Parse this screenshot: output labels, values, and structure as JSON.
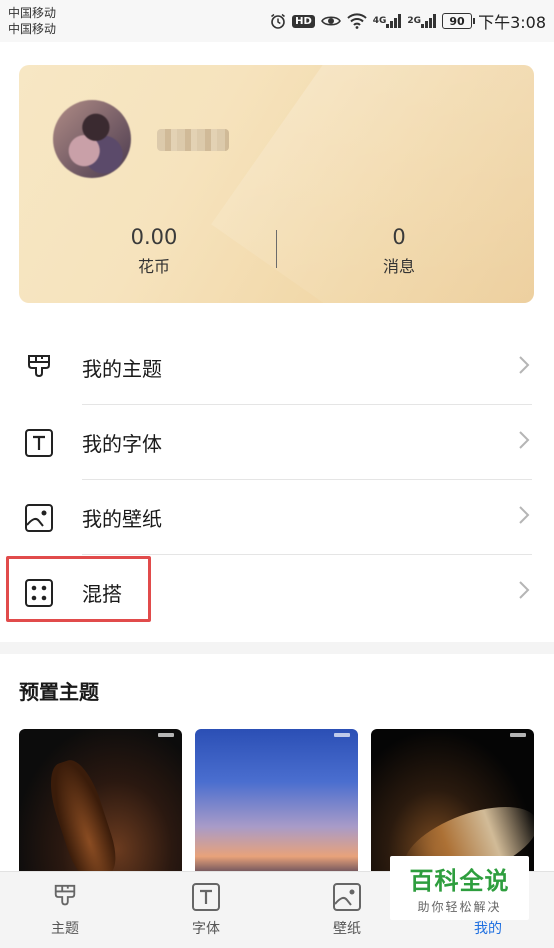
{
  "status_bar": {
    "carrier_1": "中国移动",
    "carrier_2": "中国移动",
    "net_1": "4G",
    "net_2": "2G",
    "hd": "HD",
    "battery": "90",
    "time": "下午3:08",
    "icons": [
      "alarm-icon",
      "hd-icon",
      "eye-icon",
      "wifi-icon",
      "signal-icon",
      "signal-icon",
      "battery-icon"
    ]
  },
  "profile": {
    "stats": [
      {
        "value": "0.00",
        "label": "花币"
      },
      {
        "value": "0",
        "label": "消息"
      }
    ]
  },
  "menu": {
    "items": [
      {
        "label": "我的主题",
        "icon": "brush-icon"
      },
      {
        "label": "我的字体",
        "icon": "font-icon"
      },
      {
        "label": "我的壁纸",
        "icon": "wallpaper-icon"
      },
      {
        "label": "混搭",
        "icon": "dice-icon"
      }
    ],
    "highlighted_index": 3,
    "highlight_color": "#e14b4b"
  },
  "preset": {
    "title": "预置主题"
  },
  "bottom_nav": {
    "tabs": [
      {
        "label": "主题",
        "icon": "brush-icon"
      },
      {
        "label": "字体",
        "icon": "font-icon"
      },
      {
        "label": "壁纸",
        "icon": "wallpaper-icon"
      },
      {
        "label": "我的",
        "icon": "profile-icon"
      }
    ],
    "active_index": 3,
    "active_color": "#1e6fe0"
  },
  "watermark": {
    "title": "百科全说",
    "subtitle": "助你轻松解决"
  }
}
